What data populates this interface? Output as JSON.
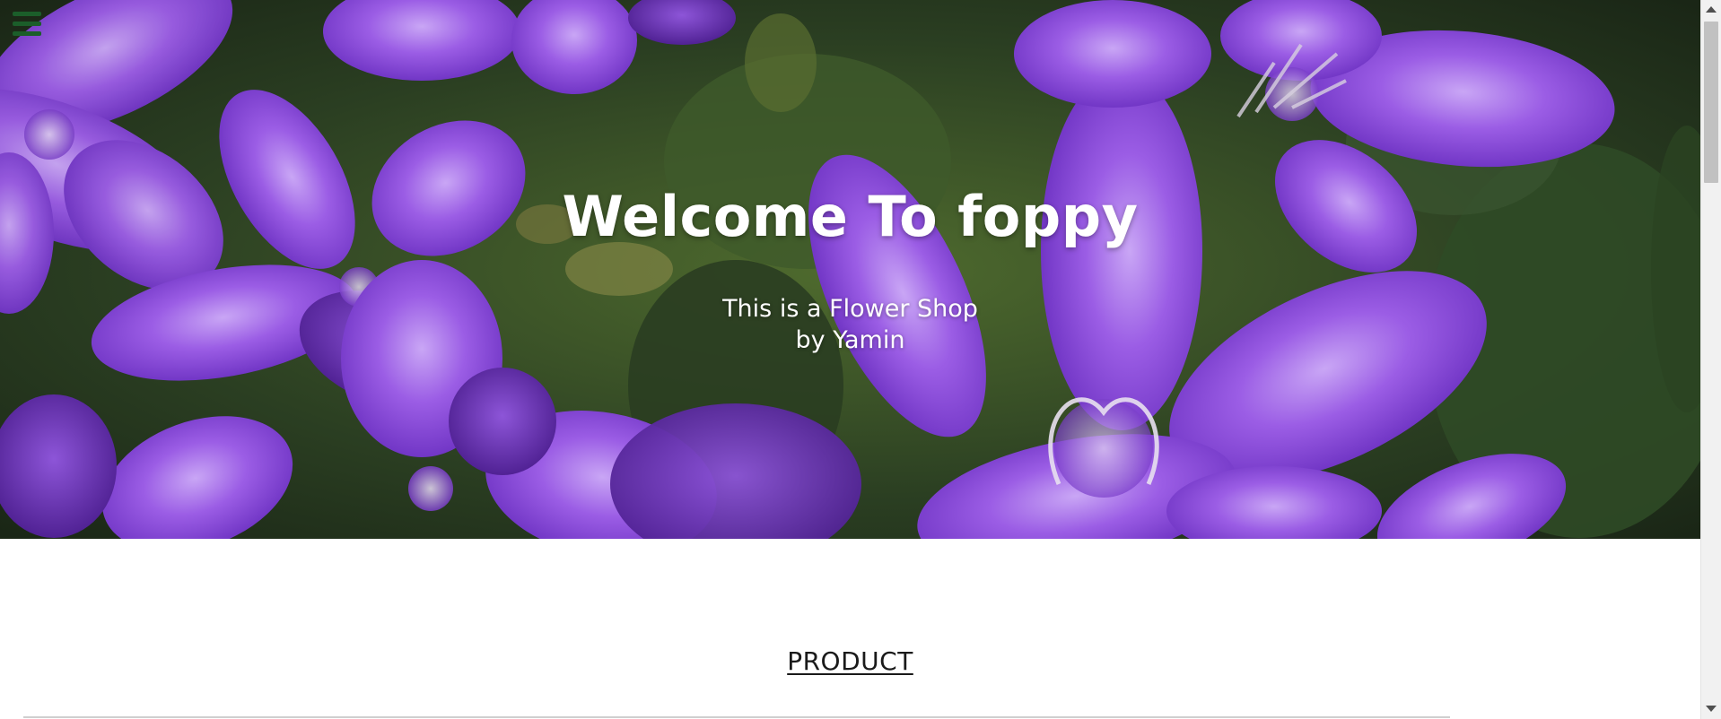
{
  "hero": {
    "title": "Welcome To foppy",
    "subtitle_line1": "This is a Flower Shop",
    "subtitle_line2": "by Yamin",
    "background_icon": "purple-flowers-photo"
  },
  "nav": {
    "menu_icon": "hamburger-menu-icon",
    "menu_color": "#1b5e2a"
  },
  "sections": {
    "product_heading": "PRODUCT"
  },
  "colors": {
    "petal": "#8e4fd6",
    "petal_light": "#b184ee",
    "foliage": "#2f4a26"
  }
}
